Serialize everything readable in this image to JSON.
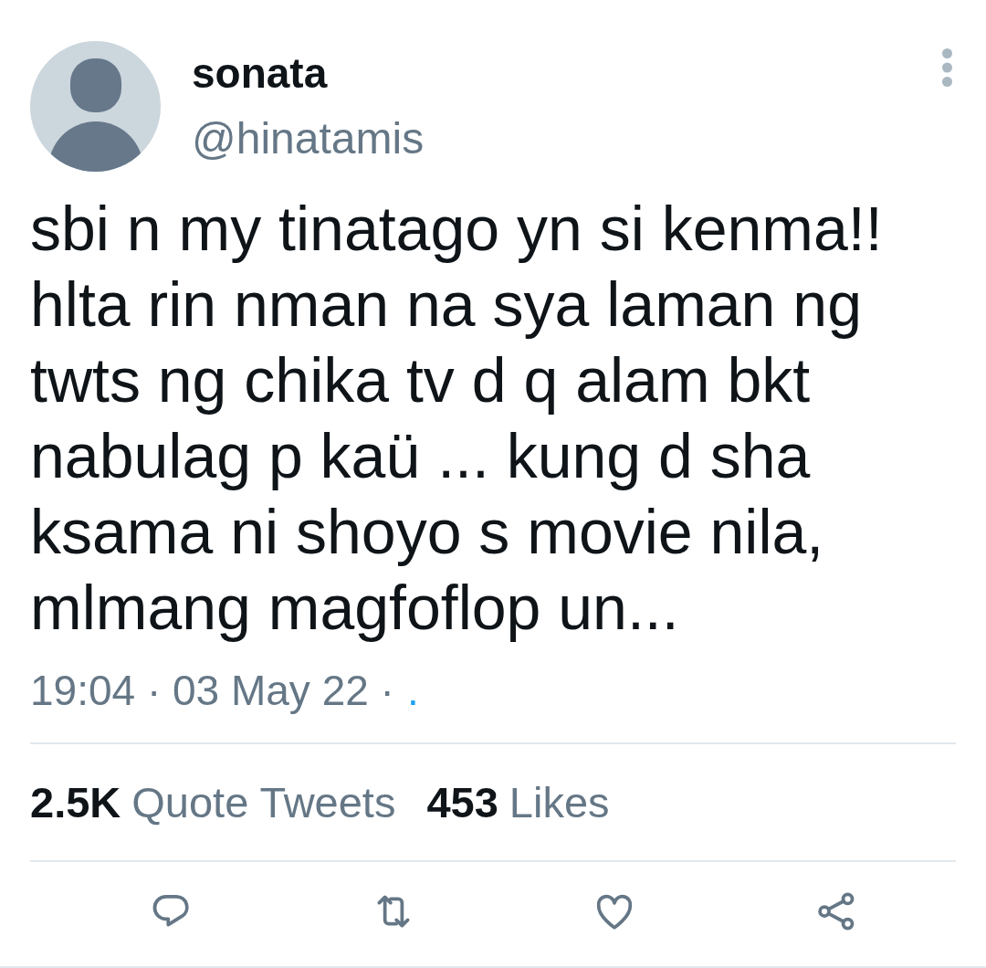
{
  "author": {
    "name": "sonata",
    "handle": "@hinatamis"
  },
  "tweet": {
    "text": "sbi n my tinatago yn si kenma!!\nhlta rin nman na sya laman ng\ntwts ng chika tv d q alam bkt\nnabulag p kaü ... kung d sha\nksama ni shoyo s movie nila,\nmlmang magfoflop un..."
  },
  "meta": {
    "time": "19:04",
    "separator": "·",
    "date": "03 May 22",
    "source": "."
  },
  "stats": [
    {
      "count": "2.5K",
      "label": "Quote Tweets"
    },
    {
      "count": "453",
      "label": "Likes"
    }
  ]
}
